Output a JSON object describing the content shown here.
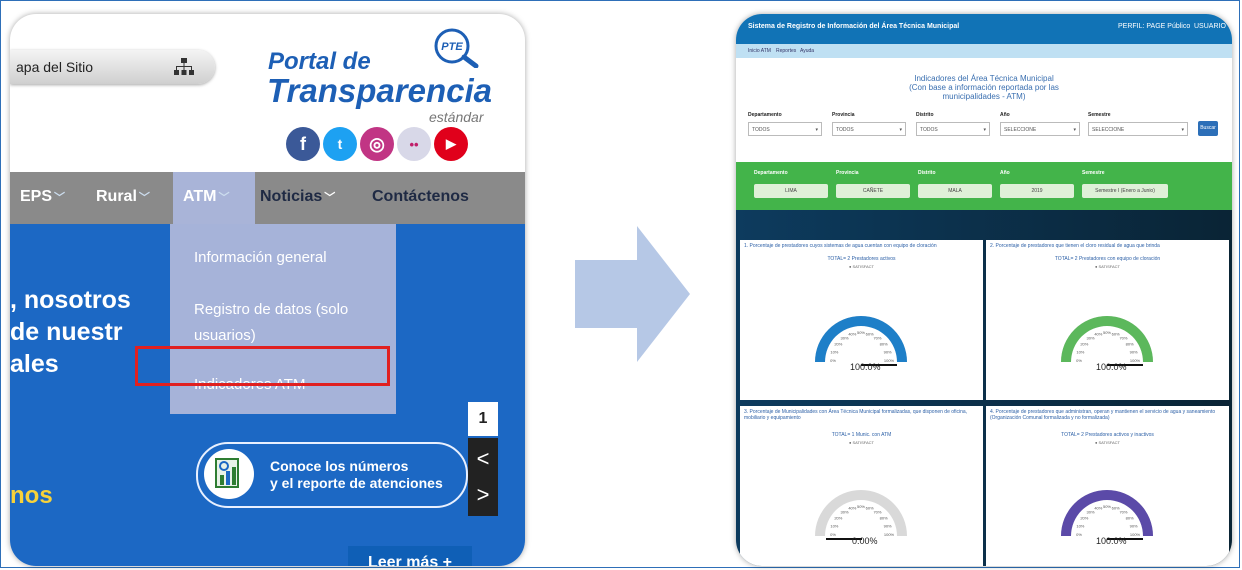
{
  "left": {
    "mapa_label": "apa del Sitio",
    "logo": {
      "line1": "Portal de",
      "line2": "Transparencia",
      "sub": "estándar",
      "badge": "PTE"
    },
    "social": [
      {
        "name": "facebook",
        "glyph": "f",
        "color": "#3b5998"
      },
      {
        "name": "twitter",
        "glyph": "t",
        "color": "#1da1f2"
      },
      {
        "name": "instagram",
        "glyph": "◎",
        "color": "#c13584"
      },
      {
        "name": "flickr",
        "glyph": "••",
        "color": "#d8d8e8"
      },
      {
        "name": "youtube",
        "glyph": "▶",
        "color": "#e0001b"
      }
    ],
    "nav": {
      "eps": "EPS",
      "rural": "Rural",
      "atm": "ATM",
      "noticias": "Noticias",
      "contactenos": "Contáctenos"
    },
    "dropdown": {
      "item1": "Información general",
      "item2a": "Registro de datos (solo",
      "item2b": "usuarios)",
      "item3": "Indicadores ATM"
    },
    "hero": {
      "line1": ", nosotros",
      "line2": "de nuestr",
      "line3": "ales",
      "highlight": "nos"
    },
    "slider": {
      "number": "1",
      "prev": "<",
      "next": ">"
    },
    "conoce": "Conoce los números\ny el reporte de atenciones",
    "leer_mas": "Leer más +"
  },
  "right": {
    "topbar": {
      "title": "Sistema de Registro de Información del Área Técnica Municipal",
      "user1": "PERFIL: PAGE Público",
      "user2": "USUARIO"
    },
    "subnav": [
      "Inicio ATM",
      "Reportes",
      "Ayuda"
    ],
    "heading": {
      "line1": "Indicadores del Área Técnica Municipal",
      "line2": "(Con base a información reportada por las municipalidades - ATM)"
    },
    "filters": [
      {
        "label": "Departamento",
        "value": "TODOS"
      },
      {
        "label": "Provincia",
        "value": "TODOS"
      },
      {
        "label": "Distrito",
        "value": "TODOS"
      },
      {
        "label": "Año",
        "value": "SELECCIONE"
      },
      {
        "label": "Semestre",
        "value": "SELECCIONE"
      }
    ],
    "buscar": "Buscar",
    "green": [
      {
        "label": "Departamento",
        "value": "LIMA"
      },
      {
        "label": "Provincia",
        "value": "CAÑETE"
      },
      {
        "label": "Distrito",
        "value": "MALA"
      },
      {
        "label": "Año",
        "value": "2019"
      },
      {
        "label": "Semestre",
        "value": "Semestre I (Enero a Junio)"
      }
    ],
    "cards": [
      {
        "title": "1. Porcentaje de prestadores cuyos sistemas de agua cuentan con equipo de cloración",
        "sub": "TOTAL= 2 Prestadores activos",
        "sub2": "● SATISFACT",
        "pct": "100.0%",
        "level": 1.0,
        "color": "#1e7fc8"
      },
      {
        "title": "2. Porcentaje de prestadores que tienen el cloro residual de agua que brinda",
        "sub": "TOTAL= 2 Prestadores con equipo de cloración",
        "sub2": "● SATISFACT",
        "pct": "100.0%",
        "level": 1.0,
        "color": "#5cb85c"
      },
      {
        "title": "3. Porcentaje de Municipalidades con Área Técnica Municipal formalizadas, que disponen de oficina, mobiliario y equipamiento",
        "sub": "TOTAL= 1 Munic. con ATM",
        "sub2": "● SATISFACT",
        "pct": "0.00%",
        "level": 0.0,
        "color": "#cfcfcf"
      },
      {
        "title": "4. Porcentaje de prestadores que administran, operan y mantienen el servicio de agua y saneamiento (Organización Comunal formalizada y no formalizada)",
        "sub": "TOTAL= 2 Prestadores activos y inactivos",
        "sub2": "● SATISFACT",
        "pct": "100.0%",
        "level": 1.0,
        "color": "#5b4aa8"
      }
    ],
    "gauge_ticks": [
      "0%",
      "10%",
      "20%",
      "30%",
      "40%",
      "50%",
      "60%",
      "70%",
      "80%",
      "90%",
      "100%"
    ]
  }
}
